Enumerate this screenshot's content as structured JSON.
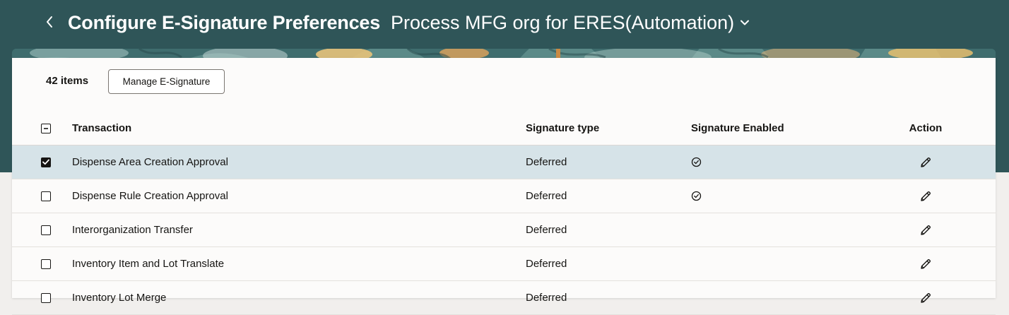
{
  "header": {
    "title": "Configure E-Signature Preferences",
    "organization": "Process MFG org for ERES(Automation)"
  },
  "toolbar": {
    "item_count": "42 items",
    "manage_label": "Manage E-Signature"
  },
  "table": {
    "columns": {
      "transaction": "Transaction",
      "signature_type": "Signature type",
      "signature_enabled": "Signature Enabled",
      "action": "Action"
    },
    "rows": [
      {
        "transaction": "Dispense Area Creation Approval",
        "signature_type": "Deferred",
        "enabled": true,
        "selected": true
      },
      {
        "transaction": "Dispense Rule Creation Approval",
        "signature_type": "Deferred",
        "enabled": true,
        "selected": false
      },
      {
        "transaction": "Interorganization Transfer",
        "signature_type": "Deferred",
        "enabled": false,
        "selected": false
      },
      {
        "transaction": "Inventory Item and Lot Translate",
        "signature_type": "Deferred",
        "enabled": false,
        "selected": false
      },
      {
        "transaction": "Inventory Lot Merge",
        "signature_type": "Deferred",
        "enabled": false,
        "selected": false
      }
    ]
  },
  "icons": {
    "back": "chevron-left-icon",
    "org_dropdown": "chevron-down-icon",
    "enabled": "check-circle-icon",
    "edit": "pencil-icon"
  },
  "colors": {
    "header_bg": "#2f5558",
    "selected_row": "#d6e3e8",
    "card_bg": "#fcfbfa"
  }
}
